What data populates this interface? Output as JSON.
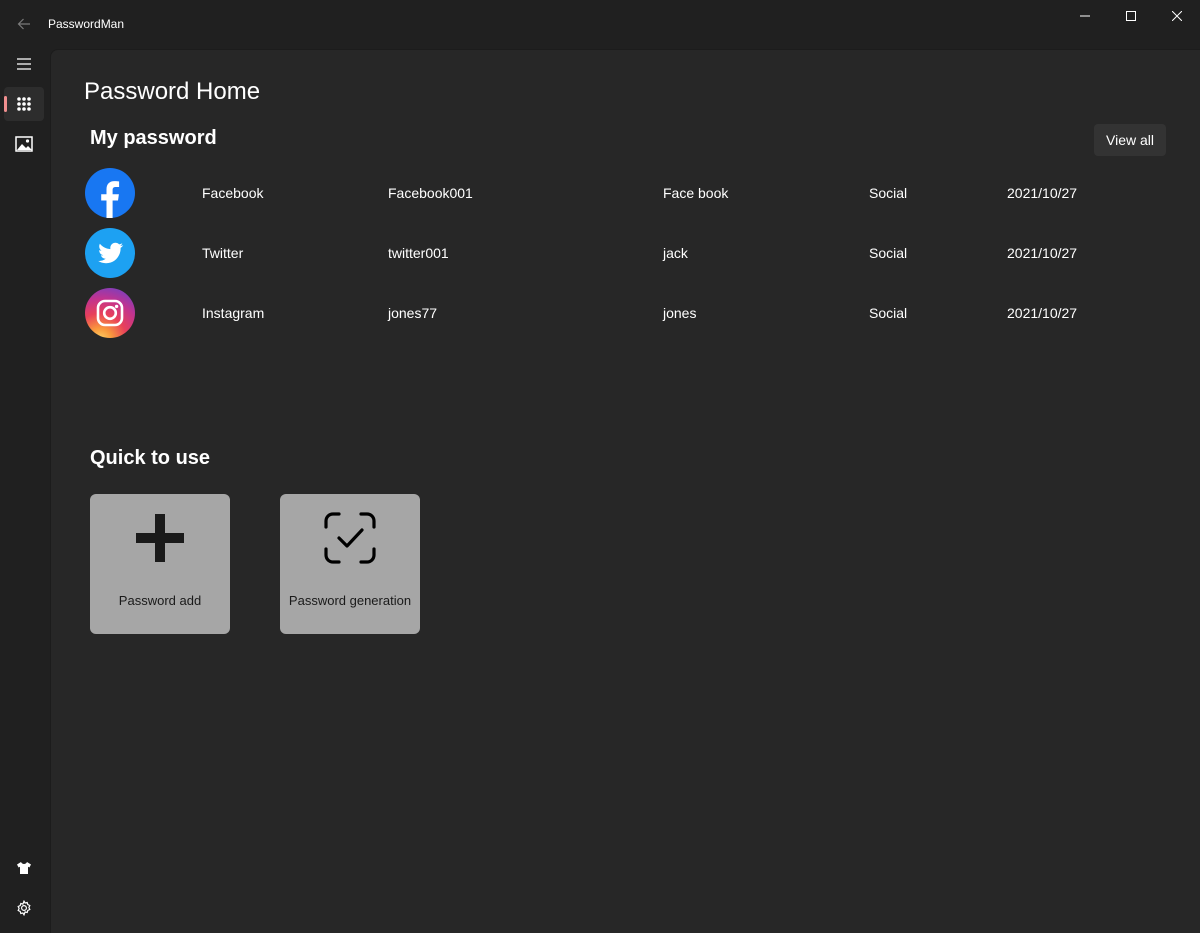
{
  "window": {
    "title": "PasswordMan"
  },
  "nav": {
    "items": [
      {
        "name": "menu",
        "icon": "hamburger-menu-icon"
      },
      {
        "name": "home",
        "icon": "dialpad-grid-icon",
        "selected": true
      },
      {
        "name": "gallery",
        "icon": "image-icon"
      },
      {
        "name": "theme",
        "icon": "tshirt-icon"
      },
      {
        "name": "settings",
        "icon": "gear-icon"
      }
    ],
    "accent": "#f08f8f"
  },
  "page": {
    "title": "Password Home"
  },
  "my_password": {
    "title": "My password",
    "view_all_label": "View all",
    "rows": [
      {
        "icon": "facebook-logo-icon",
        "site": "Facebook",
        "user": "Facebook001",
        "name": "Face book",
        "category": "Social",
        "date": "2021/10/27"
      },
      {
        "icon": "twitter-logo-icon",
        "site": "Twitter",
        "user": "twitter001",
        "name": "jack",
        "category": "Social",
        "date": "2021/10/27"
      },
      {
        "icon": "instagram-logo-icon",
        "site": "Instagram",
        "user": "jones77",
        "name": "jones",
        "category": "Social",
        "date": "2021/10/27"
      }
    ]
  },
  "quick_use": {
    "title": "Quick to use",
    "tiles": [
      {
        "label": "Password add",
        "icon": "plus-icon"
      },
      {
        "label": "Password generation",
        "icon": "scan-check-icon"
      }
    ]
  },
  "colors": {
    "background": "#202020",
    "panel": "#272727",
    "tile": "#a6a6a6",
    "facebook": "#1877f2",
    "twitter": "#1da1f2"
  }
}
